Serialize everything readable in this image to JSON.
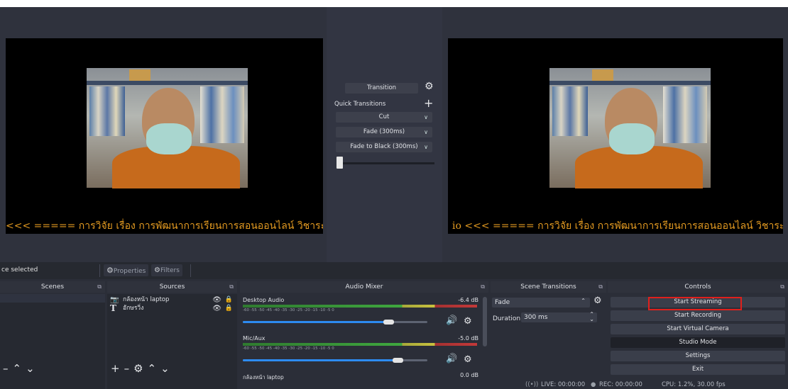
{
  "preview": {
    "ticker_left": "<<< ===== การวิจัย เรื่อง การพัฒนาการเรียนการสอนออนไลน์ วิชาระเบี",
    "ticker_right": "io <<< ===== การวิจัย เรื่อง การพัฒนาการเรียนการสอนออนไลน์ วิชาระเบี"
  },
  "transitions_panel": {
    "transition_label": "Transition",
    "quick_transitions_label": "Quick Transitions",
    "add_symbol": "+",
    "items": [
      "Cut",
      "Fade (300ms)",
      "Fade to Black (300ms)"
    ]
  },
  "context_bar": {
    "no_source": "ce selected",
    "properties": "Properties",
    "filters": "Filters"
  },
  "scenes": {
    "title": "Scenes"
  },
  "sources": {
    "title": "Sources",
    "items": [
      {
        "name": "กล้องหน้า laptop",
        "icon": "camera-icon"
      },
      {
        "name": "อักษรวิ่ง",
        "icon": "text-icon"
      }
    ]
  },
  "audio_mixer": {
    "title": "Audio Mixer",
    "channels": [
      {
        "name": "Desktop Audio",
        "db": "-6.4 dB",
        "volume": 0.85
      },
      {
        "name": "Mic/Aux",
        "db": "-5.0 dB",
        "volume": 0.87
      },
      {
        "name": "กล้องหน้า laptop",
        "db": "0.0 dB"
      }
    ],
    "scale": "-60  -55  -50  -45  -40  -35  -30  -25  -20  -15  -10  -5  0"
  },
  "scene_transitions": {
    "title": "Scene Transitions",
    "selected": "Fade",
    "duration_label": "Duration",
    "duration_value": "300 ms"
  },
  "controls": {
    "title": "Controls",
    "buttons": [
      "Start Streaming",
      "Start Recording",
      "Start Virtual Camera",
      "Studio Mode",
      "Settings",
      "Exit"
    ],
    "highlight_color": "#e0201c"
  },
  "status": {
    "live": "LIVE: 00:00:00",
    "rec": "REC: 00:00:00",
    "cpu": "CPU: 1.2%, 30.00 fps"
  }
}
